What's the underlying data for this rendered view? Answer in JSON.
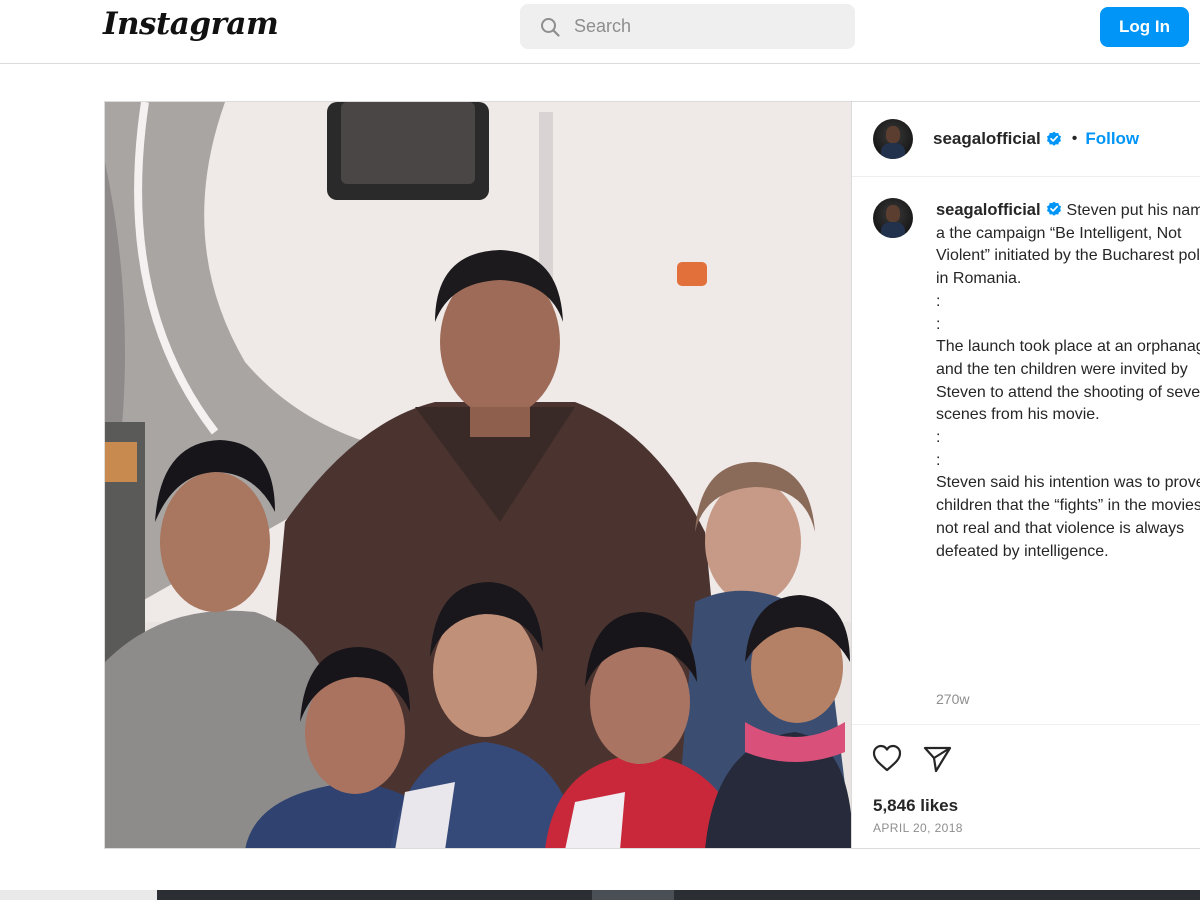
{
  "header": {
    "logo": "Instagram",
    "search_placeholder": "Search",
    "login_label": "Log In"
  },
  "post": {
    "author": "seagalofficial",
    "verified": true,
    "separator": "•",
    "follow_label": "Follow",
    "caption": "Steven put his name to a the campaign “Be Intelligent, Not Violent” initiated by the Bucharest police in Romania.\n:\n:\nThe launch took place at an orphanage and the ten children were invited by Steven to attend the shooting of several scenes from his movie.\n:\n:\nSteven said his intention was to prove to children that the “fights” in the movies are not real and that violence is always defeated by intelligence.",
    "time_ago": "270w",
    "likes": "5,846 likes",
    "date": "APRIL 20, 2018"
  },
  "colors": {
    "accent": "#0095f6",
    "muted": "#8e8e8e",
    "border": "#dbdbdb"
  },
  "icons": [
    "search-icon",
    "verified-badge-icon",
    "heart-icon",
    "share-icon"
  ]
}
